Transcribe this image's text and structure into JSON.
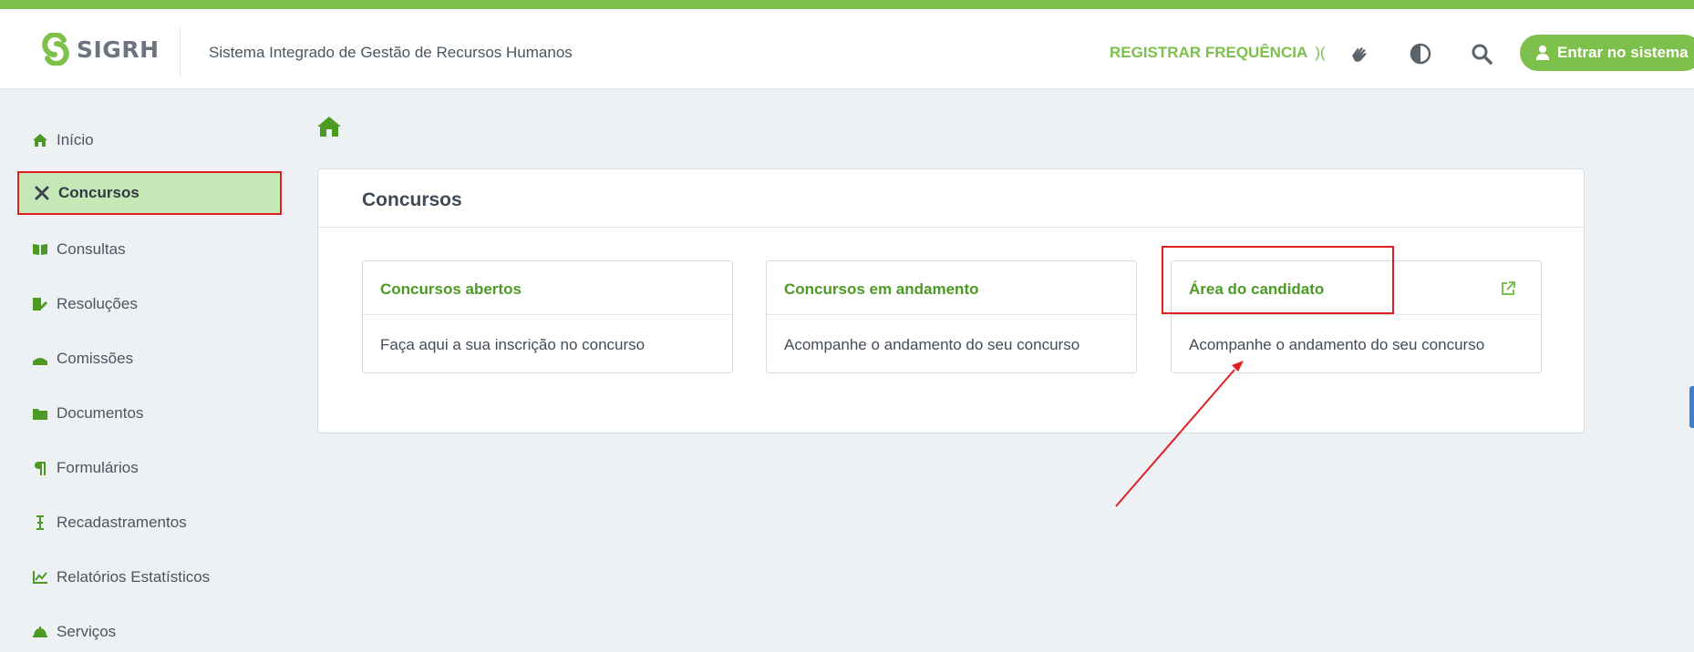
{
  "header": {
    "logo_text": "SIGRH",
    "system_name": "Sistema Integrado de Gestão de Recursos Humanos",
    "register_label": "REGISTRAR FREQUÊNCIA",
    "register_mark": ")(",
    "login_label": "Entrar no sistema",
    "icons": [
      "libras-hand-icon",
      "contrast-icon",
      "search-icon"
    ]
  },
  "sidebar": {
    "items": [
      {
        "label": "Início",
        "icon": "home-icon"
      },
      {
        "label": "Concursos",
        "icon": "tools-icon",
        "active": true
      },
      {
        "label": "Consultas",
        "icon": "book-icon"
      },
      {
        "label": "Resoluções",
        "icon": "edit-file-icon"
      },
      {
        "label": "Comissões",
        "icon": "group-icon"
      },
      {
        "label": "Documentos",
        "icon": "folder-icon"
      },
      {
        "label": "Formulários",
        "icon": "paragraph-icon"
      },
      {
        "label": "Recadastramentos",
        "icon": "cursor-icon"
      },
      {
        "label": "Relatórios Estatísticos",
        "icon": "chart-icon"
      },
      {
        "label": "Serviços",
        "icon": "bell-icon"
      }
    ]
  },
  "main": {
    "panel_title": "Concursos",
    "cards": [
      {
        "title": "Concursos abertos",
        "description": "Faça aqui a sua inscrição no concurso"
      },
      {
        "title": "Concursos em andamento",
        "description": "Acompanhe o andamento do seu concurso"
      },
      {
        "title": "Área do candidato",
        "description": "Acompanhe o andamento do seu concurso",
        "external": true
      }
    ]
  },
  "colors": {
    "brand_green": "#7dc04b",
    "link_green": "#4c9a24",
    "active_bg": "#c6e8b6",
    "highlight_red": "#e02020"
  }
}
